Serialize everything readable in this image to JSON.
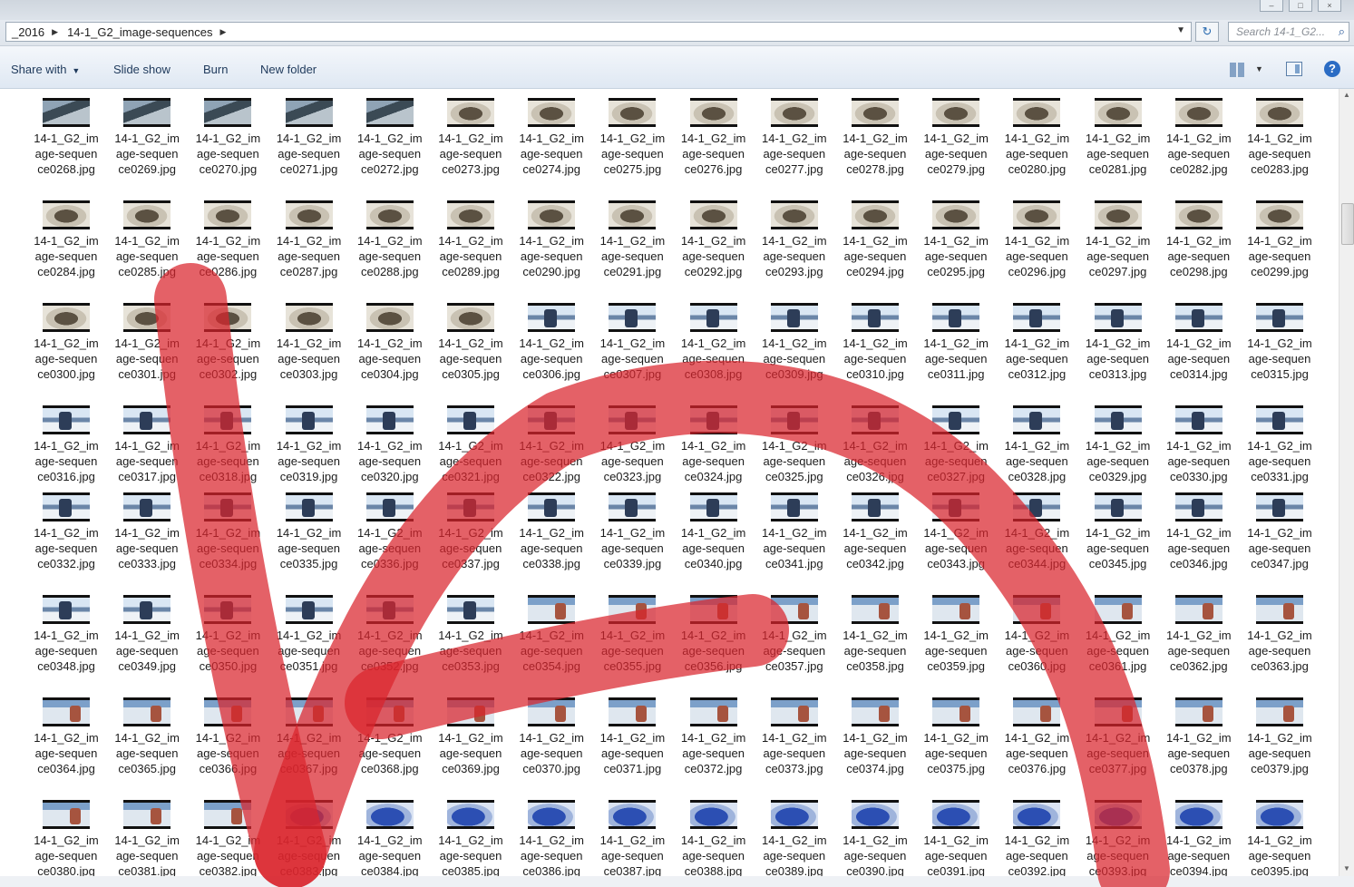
{
  "window": {
    "address": {
      "crumbs": [
        "_2016",
        "14-1_G2_image-sequences"
      ],
      "separator_icon": "chevron-right-icon",
      "dropdown_icon": "chevron-down-icon"
    },
    "refresh_icon": "refresh-icon",
    "search": {
      "placeholder": "Search 14-1_G2...",
      "icon": "search-icon"
    }
  },
  "toolbar": {
    "share_with": "Share with",
    "slide_show": "Slide show",
    "burn": "Burn",
    "new_folder": "New folder",
    "views_icon": "views-icon",
    "pane_icon": "preview-pane-icon",
    "help_icon": "help-icon",
    "help_glyph": "?"
  },
  "files": {
    "name_line1": "14-1_G2_im",
    "name_line2": "age-sequen",
    "first_number": 268,
    "visible_rows": [
      {
        "start": 268,
        "thumb": "aaaaabbbbbbbbbbb"
      },
      {
        "start": 284,
        "thumb": "bbbbbbbbbbbbbbbb"
      },
      {
        "start": 300,
        "thumb": "bbbbbbcccccccccc"
      },
      {
        "start": 316,
        "thumb": "cccccccccccccccc"
      },
      {
        "start": 332,
        "thumb": "cccccccccccccccc"
      },
      {
        "start": 348,
        "thumb": "ccccccdddddddddd"
      },
      {
        "start": 364,
        "thumb": "dddddddddddddddd"
      },
      {
        "start": 380,
        "thumb": "dddeeeeeeeeeeeee"
      }
    ]
  },
  "annotation": {
    "description": "red hand-drawn stroke overlay",
    "color": "#d9242c",
    "opacity": 0.72
  }
}
